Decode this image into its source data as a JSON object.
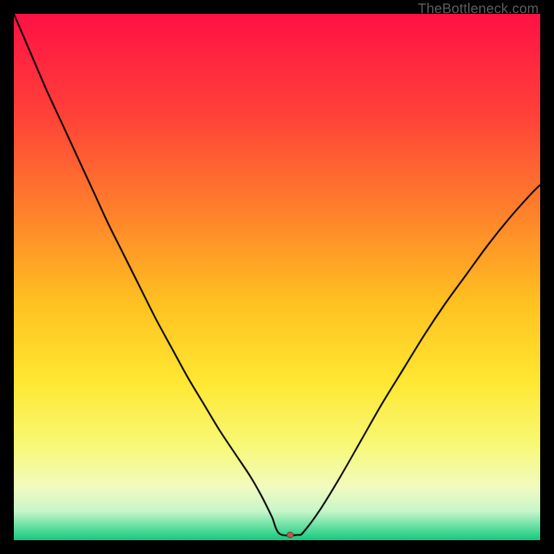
{
  "watermark": "TheBottleneck.com",
  "chart_data": {
    "type": "line",
    "title": "",
    "xlabel": "",
    "ylabel": "",
    "xlim": [
      0,
      100
    ],
    "ylim": [
      0,
      100
    ],
    "grid": false,
    "legend": false,
    "background_gradient": {
      "stops": [
        {
          "pos": 0.0,
          "color": "#ff1145"
        },
        {
          "pos": 0.2,
          "color": "#ff4438"
        },
        {
          "pos": 0.4,
          "color": "#ff8a2a"
        },
        {
          "pos": 0.55,
          "color": "#ffc221"
        },
        {
          "pos": 0.7,
          "color": "#ffe833"
        },
        {
          "pos": 0.82,
          "color": "#f8f977"
        },
        {
          "pos": 0.9,
          "color": "#f1fbc0"
        },
        {
          "pos": 0.945,
          "color": "#c8f6ca"
        },
        {
          "pos": 0.975,
          "color": "#63dfa0"
        },
        {
          "pos": 1.0,
          "color": "#14c980"
        }
      ]
    },
    "series": [
      {
        "name": "bottleneck-curve",
        "color": "#000000",
        "width": 2.4,
        "x": [
          0,
          3,
          6,
          9,
          12,
          15,
          18,
          21,
          24,
          27,
          30,
          33,
          36,
          39,
          42,
          45,
          47,
          49,
          50.5,
          54,
          55,
          58,
          62,
          66,
          70,
          74,
          78,
          82,
          86,
          90,
          94,
          98,
          100
        ],
        "y": [
          100,
          93,
          86,
          79.5,
          73,
          66.5,
          60,
          54,
          48,
          42,
          36.5,
          31,
          26,
          21,
          16.5,
          12,
          8.5,
          4.5,
          1.2,
          1.0,
          1.5,
          5.5,
          12,
          19,
          26,
          32.5,
          39,
          45,
          50.5,
          56,
          61,
          65.5,
          67.5
        ]
      }
    ],
    "marker": {
      "name": "optimal-point",
      "x": 52.5,
      "y": 1.0,
      "rx": 5,
      "ry": 4,
      "fill": "#c05a4a",
      "stroke": "#5a2a22"
    }
  }
}
